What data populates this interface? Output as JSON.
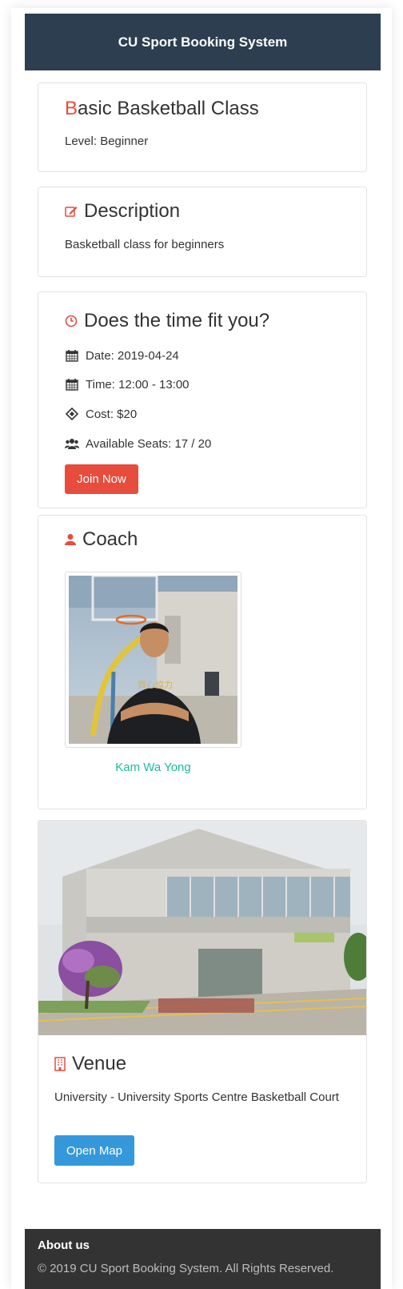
{
  "app": {
    "title": "CU Sport Booking System"
  },
  "class_card": {
    "title_first": "B",
    "title_rest": "asic Basketball Class",
    "level": "Level: Beginner"
  },
  "description": {
    "heading": "Description",
    "text": "Basketball class for beginners",
    "icon": "edit-icon"
  },
  "schedule": {
    "heading": "Does the time fit you?",
    "icon": "clock-icon",
    "date": "Date: 2019-04-24",
    "time": "Time: 12:00 - 13:00",
    "cost": "Cost: $20",
    "seats": "Available Seats: 17 / 20",
    "join_label": "Join Now"
  },
  "coach": {
    "heading": "Coach",
    "icon": "user-icon",
    "name": "Kam Wa Yong"
  },
  "venue": {
    "heading": "Venue",
    "icon": "building-icon",
    "text": "University - University Sports Centre Basketball Court",
    "map_label": "Open Map"
  },
  "footer": {
    "about": "About us",
    "copyright": "© 2019 CU Sport Booking System. All Rights Reserved."
  },
  "colors": {
    "navbar": "#2c3e50",
    "accent_red": "#e74c3c",
    "button_blue": "#3498db",
    "link_teal": "#1abc9c",
    "footer": "#333333"
  }
}
